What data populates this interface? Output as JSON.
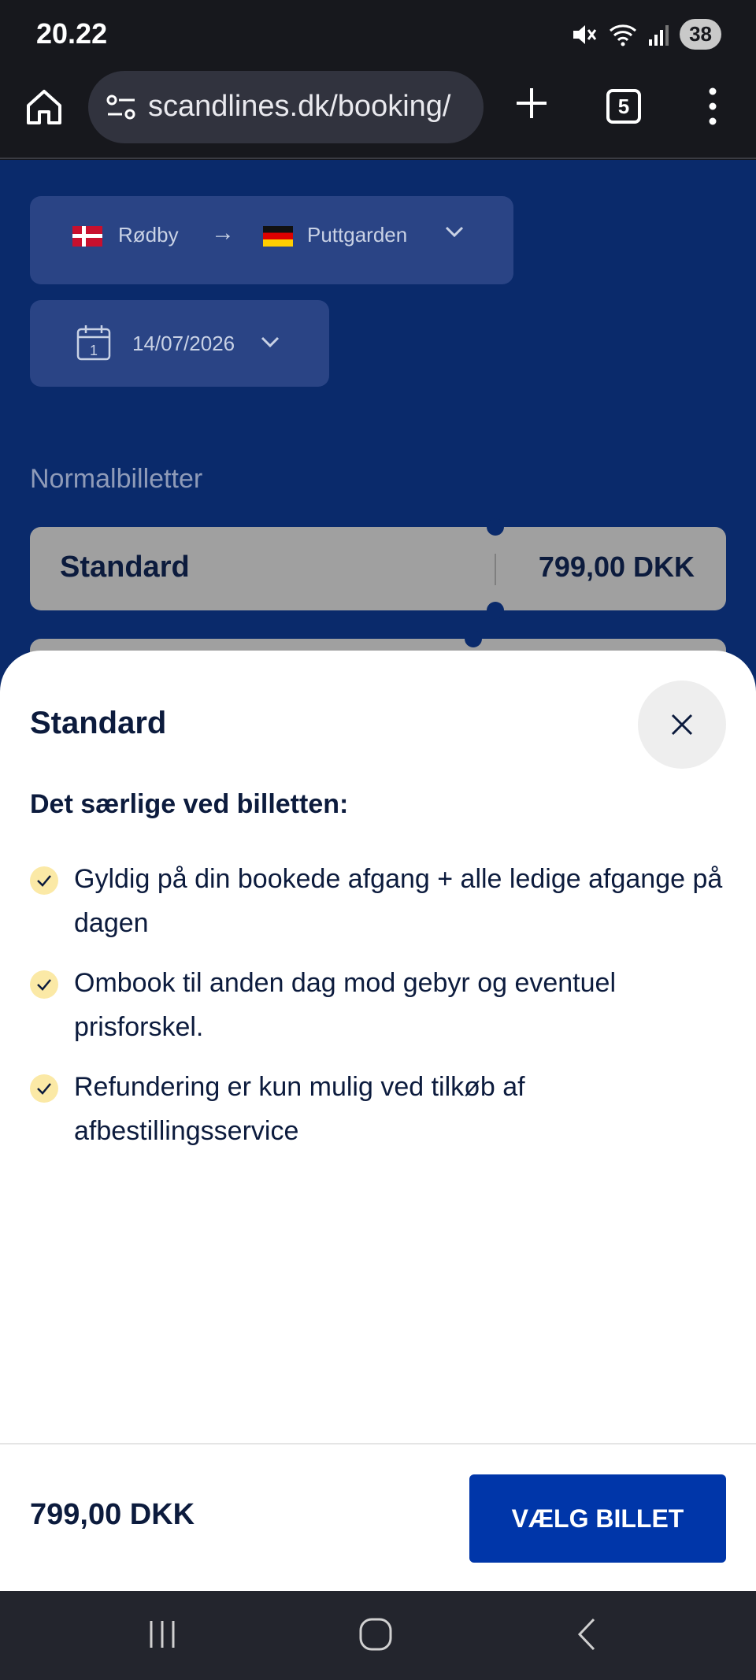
{
  "status_bar": {
    "time": "20.22",
    "battery": "38"
  },
  "browser": {
    "url": "scandlines.dk/booking/",
    "tab_count": "5"
  },
  "route": {
    "from": "Rødby",
    "arrow": "→",
    "to": "Puttgarden"
  },
  "date": {
    "value": "14/07/2026",
    "calendar_day": "1"
  },
  "section_label": "Normalbilletter",
  "ticket": {
    "name": "Standard",
    "price": "799,00 DKK"
  },
  "sheet": {
    "title": "Standard",
    "subtitle": "Det særlige ved billetten:",
    "features": [
      "Gyldig på din bookede afgang + alle ledige afgange på dagen",
      "Ombook til anden dag mod gebyr og eventuel prisforskel.",
      "Refundering er kun mulig ved tilkøb af afbestillingsservice"
    ],
    "footer_price": "799,00 DKK",
    "choose_label": "VÆLG BILLET"
  },
  "colors": {
    "page_bg": "#0a2a6b",
    "button_blue": "#0036a9",
    "check_bg": "#fbe9a6",
    "text_dark": "#0c1b3d"
  }
}
